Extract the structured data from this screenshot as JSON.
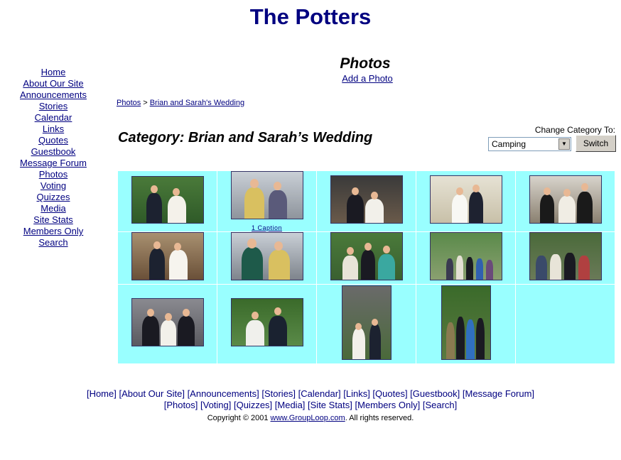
{
  "site": {
    "title": "The Potters"
  },
  "sidebar": {
    "items": [
      {
        "label": "Home"
      },
      {
        "label": "About Our Site"
      },
      {
        "label": "Announcements"
      },
      {
        "label": "Stories"
      },
      {
        "label": "Calendar"
      },
      {
        "label": "Links"
      },
      {
        "label": "Quotes"
      },
      {
        "label": "Guestbook"
      },
      {
        "label": "Message Forum"
      },
      {
        "label": "Photos"
      },
      {
        "label": "Voting"
      },
      {
        "label": "Quizzes"
      },
      {
        "label": "Media"
      },
      {
        "label": "Site Stats"
      },
      {
        "label": "Members Only"
      },
      {
        "label": "Search"
      }
    ]
  },
  "page": {
    "heading": "Photos",
    "add_photo": "Add a Photo"
  },
  "breadcrumb": {
    "root": "Photos",
    "separator": ">",
    "current": "Brian and Sarah's Wedding"
  },
  "category": {
    "title": "Category: Brian and Sarah’s Wedding",
    "change_label": "Change Category To:",
    "selected": "Camping",
    "switch_label": "Switch"
  },
  "photos": {
    "caption_link": "1 Caption"
  },
  "footer": {
    "line1": "[Home] [About Our Site] [Announcements] [Stories] [Calendar] [Links] [Quotes] [Guestbook] [Message Forum]",
    "line2": "[Photos] [Voting] [Quizzes] [Media] [Site Stats] [Members Only] [Search]",
    "copyright_pre": "Copyright © 2001 ",
    "copyright_link": "www.GroupLoop.com",
    "copyright_post": ". All rights reserved."
  },
  "colors": {
    "link": "#000080",
    "grid_cell": "#99ffff",
    "title": "#000080"
  }
}
